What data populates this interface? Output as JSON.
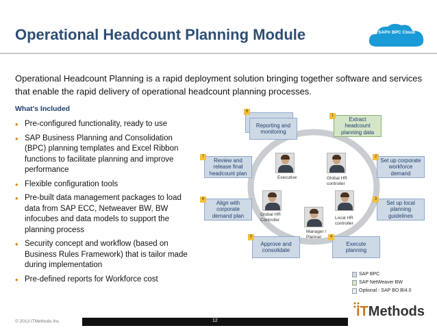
{
  "slide": {
    "title": "Operational Headcount Planning Module",
    "badge_text": "SAP® BPC Cloud",
    "intro": "Operational Headcount Planning is a rapid deployment solution bringing together software and services that enable the rapid delivery of operational headcount planning processes.",
    "included_heading": "What's Included",
    "bullets": [
      "Pre-configured functionality, ready to use",
      "SAP Business Planning and Consolidation (BPC) planning templates and Excel Ribbon functions to facilitate planning and improve performance",
      "Flexible configuration tools",
      "Pre-built data management packages to load data from SAP ECC, Netweaver BW, BW infocubes and data models to support the planning process",
      "Security concept and workflow (based on Business Rules Framework) that is tailor made during implementation",
      "Pre-defined reports for Workforce cost"
    ]
  },
  "diagram": {
    "steps": [
      {
        "num": "1",
        "label": "Extract headcount planning data"
      },
      {
        "num": "2",
        "label": "Set up corporate workforce demand"
      },
      {
        "num": "3",
        "label": "Set up local planning guidelines"
      },
      {
        "num": "4",
        "label": "Execute planning"
      },
      {
        "num": "5",
        "label": "Approve and consolidate"
      },
      {
        "num": "6",
        "label": "Align with corporate demand plan"
      },
      {
        "num": "7",
        "label": "Review and release final headcount plan"
      },
      {
        "num": "8",
        "label": "Reporting and monitoring"
      }
    ],
    "roles": [
      "Executive",
      "Global HR controller",
      "Global HR Controller",
      "Local HR controller",
      "Manager / Planner"
    ]
  },
  "legend": [
    {
      "label": "SAP BPC",
      "color": "#ced9e6"
    },
    {
      "label": "SAP NetWeaver BW",
      "color": "#d5e6c8"
    },
    {
      "label": "Optional - SAP BO BI4.0",
      "color": "#e8eef6"
    }
  ],
  "footer": {
    "copyright": "© 2013 ITMethods Inc.",
    "page": "12",
    "logo_prefix": "iT",
    "logo_suffix": "Methods"
  },
  "colors": {
    "title": "#2e4d73",
    "bullet": "#d88a1a",
    "step_number": "#f0c040"
  }
}
